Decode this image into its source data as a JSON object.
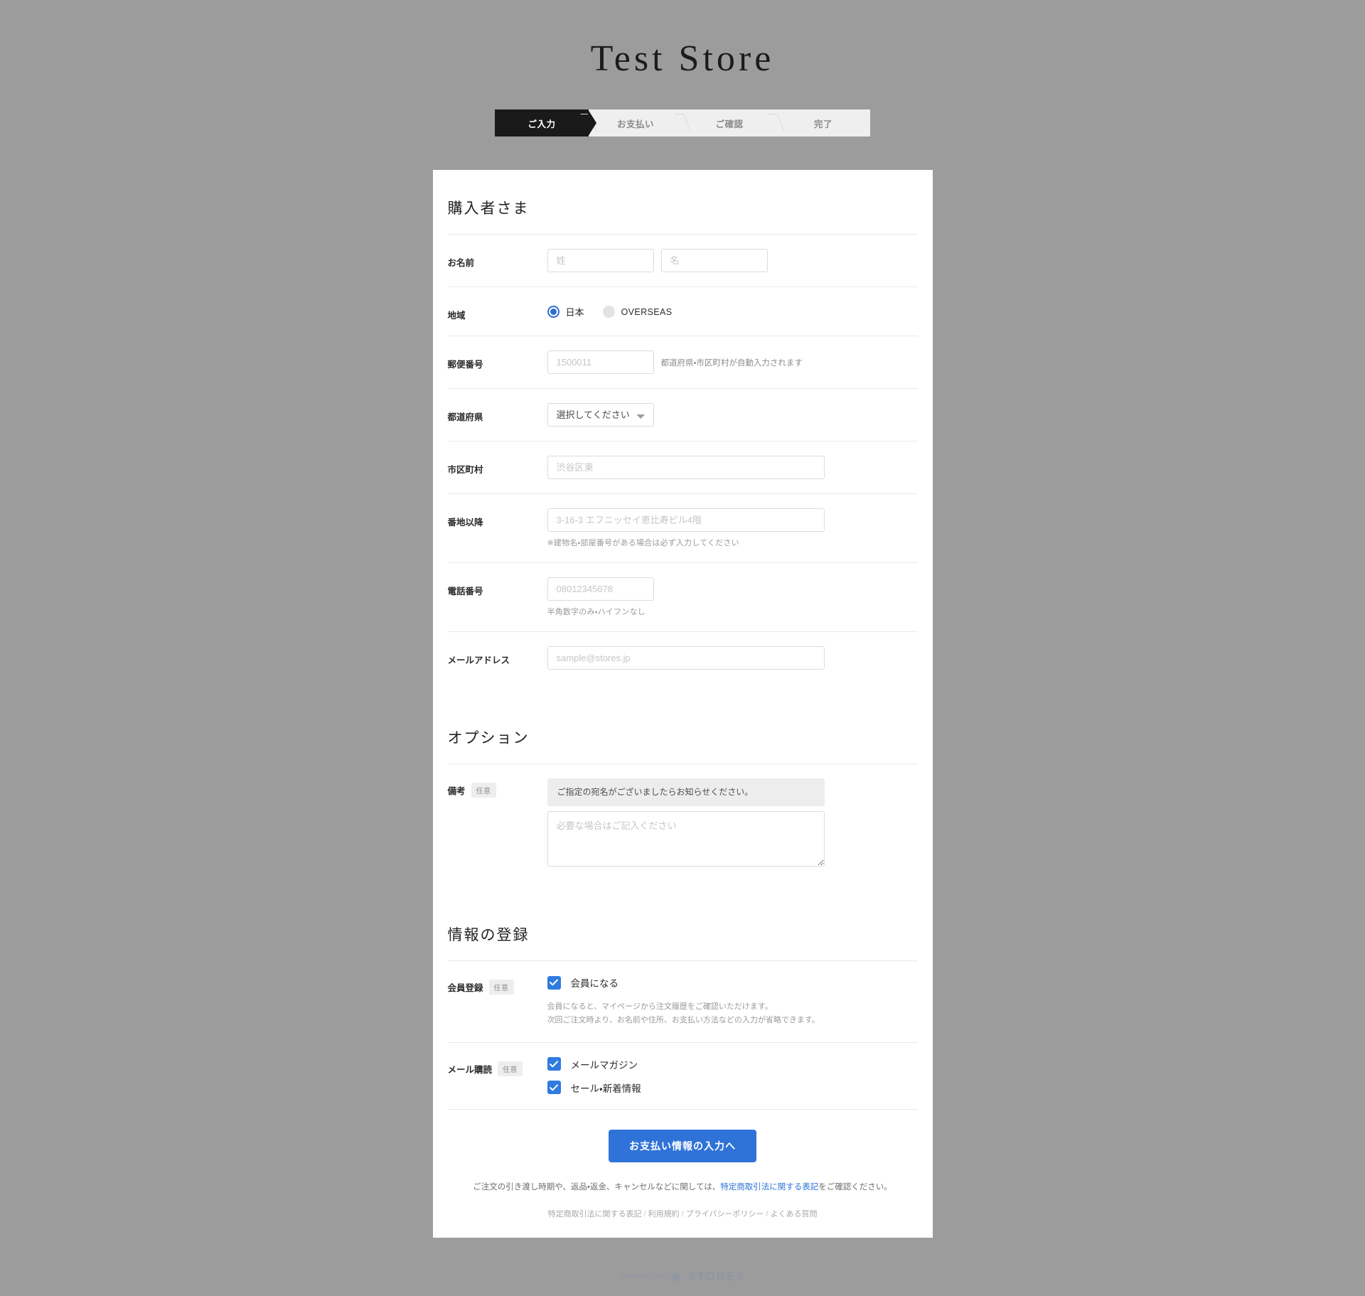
{
  "store": {
    "title": "Test Store"
  },
  "steps": [
    {
      "label": "ご入力",
      "active": true
    },
    {
      "label": "お支払い",
      "active": false
    },
    {
      "label": "ご確認",
      "active": false
    },
    {
      "label": "完了",
      "active": false
    }
  ],
  "buyer_section": {
    "heading": "購入者さま",
    "name": {
      "label": "お名前",
      "last_placeholder": "姓",
      "first_placeholder": "名"
    },
    "region": {
      "label": "地域",
      "options": [
        {
          "label": "日本",
          "selected": true
        },
        {
          "label": "OVERSEAS",
          "selected": false
        }
      ]
    },
    "postal": {
      "label": "郵便番号",
      "placeholder": "1500011",
      "hint": "都道府県・市区町村が自動入力されます"
    },
    "prefecture": {
      "label": "都道府県",
      "selected": "選択してください"
    },
    "city": {
      "label": "市区町村",
      "placeholder": "渋谷区東"
    },
    "street": {
      "label": "番地以降",
      "placeholder": "3-16-3 エフニッセイ恵比寿ビル4階",
      "hint": "※建物名・部屋番号がある場合は必ず入力してください"
    },
    "phone": {
      "label": "電話番号",
      "placeholder": "08012345678",
      "hint": "半角数字のみ・ハイフンなし"
    },
    "email": {
      "label": "メールアドレス",
      "placeholder": "sample@stores.jp"
    }
  },
  "options_section": {
    "heading": "オプション",
    "remarks": {
      "label": "備考",
      "badge": "任意",
      "note": "ご指定の宛名がございましたらお知らせください。",
      "placeholder": "必要な場合はご記入ください"
    }
  },
  "registration_section": {
    "heading": "情報の登録",
    "membership": {
      "label": "会員登録",
      "badge": "任意",
      "checkbox_label": "会員になる",
      "checked": true,
      "desc_line1": "会員になると、マイページから注文履歴をご確認いただけます。",
      "desc_line2": "次回ご注文時より、お名前や住所、お支払い方法などの入力が省略できます。"
    },
    "mail": {
      "label": "メール購読",
      "badge": "任意",
      "items": [
        {
          "label": "メールマガジン",
          "checked": true
        },
        {
          "label": "セール・新着情報",
          "checked": true
        }
      ]
    }
  },
  "submit": {
    "label": "お支払い情報の入力へ",
    "disclaimer_before": "ご注文の引き渡し時期や、返品・返金、キャンセルなどに関しては、",
    "disclaimer_link": "特定商取引法に関する表記",
    "disclaimer_after": "をご確認ください。"
  },
  "footer": {
    "links": [
      "特定商取引法に関する表記",
      "利用規約",
      "プライバシーポリシー",
      "よくある質問"
    ],
    "divider": "/"
  },
  "watermark": {
    "prefix": "powered by",
    "brand": "STORES"
  },
  "colors": {
    "accent_blue": "#2f73d8",
    "checkbox_blue": "#2f7be0",
    "radio_blue": "#2f6fd0",
    "active_step_bg": "#1a1a1a",
    "page_bg": "#9c9c9c",
    "card_bg": "#ffffff"
  }
}
